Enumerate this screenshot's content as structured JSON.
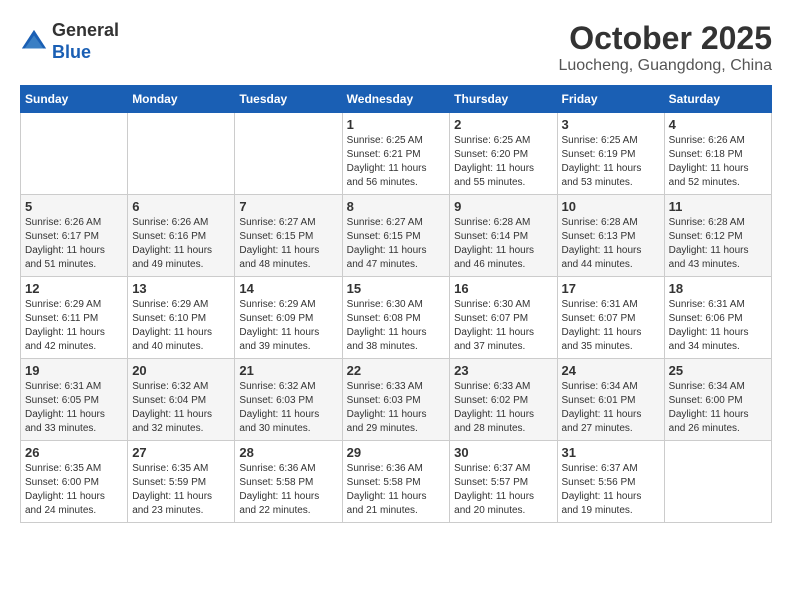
{
  "header": {
    "logo_general": "General",
    "logo_blue": "Blue",
    "month_year": "October 2025",
    "location": "Luocheng, Guangdong, China"
  },
  "weekdays": [
    "Sunday",
    "Monday",
    "Tuesday",
    "Wednesday",
    "Thursday",
    "Friday",
    "Saturday"
  ],
  "weeks": [
    [
      {
        "day": "",
        "info": ""
      },
      {
        "day": "",
        "info": ""
      },
      {
        "day": "",
        "info": ""
      },
      {
        "day": "1",
        "info": "Sunrise: 6:25 AM\nSunset: 6:21 PM\nDaylight: 11 hours\nand 56 minutes."
      },
      {
        "day": "2",
        "info": "Sunrise: 6:25 AM\nSunset: 6:20 PM\nDaylight: 11 hours\nand 55 minutes."
      },
      {
        "day": "3",
        "info": "Sunrise: 6:25 AM\nSunset: 6:19 PM\nDaylight: 11 hours\nand 53 minutes."
      },
      {
        "day": "4",
        "info": "Sunrise: 6:26 AM\nSunset: 6:18 PM\nDaylight: 11 hours\nand 52 minutes."
      }
    ],
    [
      {
        "day": "5",
        "info": "Sunrise: 6:26 AM\nSunset: 6:17 PM\nDaylight: 11 hours\nand 51 minutes."
      },
      {
        "day": "6",
        "info": "Sunrise: 6:26 AM\nSunset: 6:16 PM\nDaylight: 11 hours\nand 49 minutes."
      },
      {
        "day": "7",
        "info": "Sunrise: 6:27 AM\nSunset: 6:15 PM\nDaylight: 11 hours\nand 48 minutes."
      },
      {
        "day": "8",
        "info": "Sunrise: 6:27 AM\nSunset: 6:15 PM\nDaylight: 11 hours\nand 47 minutes."
      },
      {
        "day": "9",
        "info": "Sunrise: 6:28 AM\nSunset: 6:14 PM\nDaylight: 11 hours\nand 46 minutes."
      },
      {
        "day": "10",
        "info": "Sunrise: 6:28 AM\nSunset: 6:13 PM\nDaylight: 11 hours\nand 44 minutes."
      },
      {
        "day": "11",
        "info": "Sunrise: 6:28 AM\nSunset: 6:12 PM\nDaylight: 11 hours\nand 43 minutes."
      }
    ],
    [
      {
        "day": "12",
        "info": "Sunrise: 6:29 AM\nSunset: 6:11 PM\nDaylight: 11 hours\nand 42 minutes."
      },
      {
        "day": "13",
        "info": "Sunrise: 6:29 AM\nSunset: 6:10 PM\nDaylight: 11 hours\nand 40 minutes."
      },
      {
        "day": "14",
        "info": "Sunrise: 6:29 AM\nSunset: 6:09 PM\nDaylight: 11 hours\nand 39 minutes."
      },
      {
        "day": "15",
        "info": "Sunrise: 6:30 AM\nSunset: 6:08 PM\nDaylight: 11 hours\nand 38 minutes."
      },
      {
        "day": "16",
        "info": "Sunrise: 6:30 AM\nSunset: 6:07 PM\nDaylight: 11 hours\nand 37 minutes."
      },
      {
        "day": "17",
        "info": "Sunrise: 6:31 AM\nSunset: 6:07 PM\nDaylight: 11 hours\nand 35 minutes."
      },
      {
        "day": "18",
        "info": "Sunrise: 6:31 AM\nSunset: 6:06 PM\nDaylight: 11 hours\nand 34 minutes."
      }
    ],
    [
      {
        "day": "19",
        "info": "Sunrise: 6:31 AM\nSunset: 6:05 PM\nDaylight: 11 hours\nand 33 minutes."
      },
      {
        "day": "20",
        "info": "Sunrise: 6:32 AM\nSunset: 6:04 PM\nDaylight: 11 hours\nand 32 minutes."
      },
      {
        "day": "21",
        "info": "Sunrise: 6:32 AM\nSunset: 6:03 PM\nDaylight: 11 hours\nand 30 minutes."
      },
      {
        "day": "22",
        "info": "Sunrise: 6:33 AM\nSunset: 6:03 PM\nDaylight: 11 hours\nand 29 minutes."
      },
      {
        "day": "23",
        "info": "Sunrise: 6:33 AM\nSunset: 6:02 PM\nDaylight: 11 hours\nand 28 minutes."
      },
      {
        "day": "24",
        "info": "Sunrise: 6:34 AM\nSunset: 6:01 PM\nDaylight: 11 hours\nand 27 minutes."
      },
      {
        "day": "25",
        "info": "Sunrise: 6:34 AM\nSunset: 6:00 PM\nDaylight: 11 hours\nand 26 minutes."
      }
    ],
    [
      {
        "day": "26",
        "info": "Sunrise: 6:35 AM\nSunset: 6:00 PM\nDaylight: 11 hours\nand 24 minutes."
      },
      {
        "day": "27",
        "info": "Sunrise: 6:35 AM\nSunset: 5:59 PM\nDaylight: 11 hours\nand 23 minutes."
      },
      {
        "day": "28",
        "info": "Sunrise: 6:36 AM\nSunset: 5:58 PM\nDaylight: 11 hours\nand 22 minutes."
      },
      {
        "day": "29",
        "info": "Sunrise: 6:36 AM\nSunset: 5:58 PM\nDaylight: 11 hours\nand 21 minutes."
      },
      {
        "day": "30",
        "info": "Sunrise: 6:37 AM\nSunset: 5:57 PM\nDaylight: 11 hours\nand 20 minutes."
      },
      {
        "day": "31",
        "info": "Sunrise: 6:37 AM\nSunset: 5:56 PM\nDaylight: 11 hours\nand 19 minutes."
      },
      {
        "day": "",
        "info": ""
      }
    ]
  ]
}
